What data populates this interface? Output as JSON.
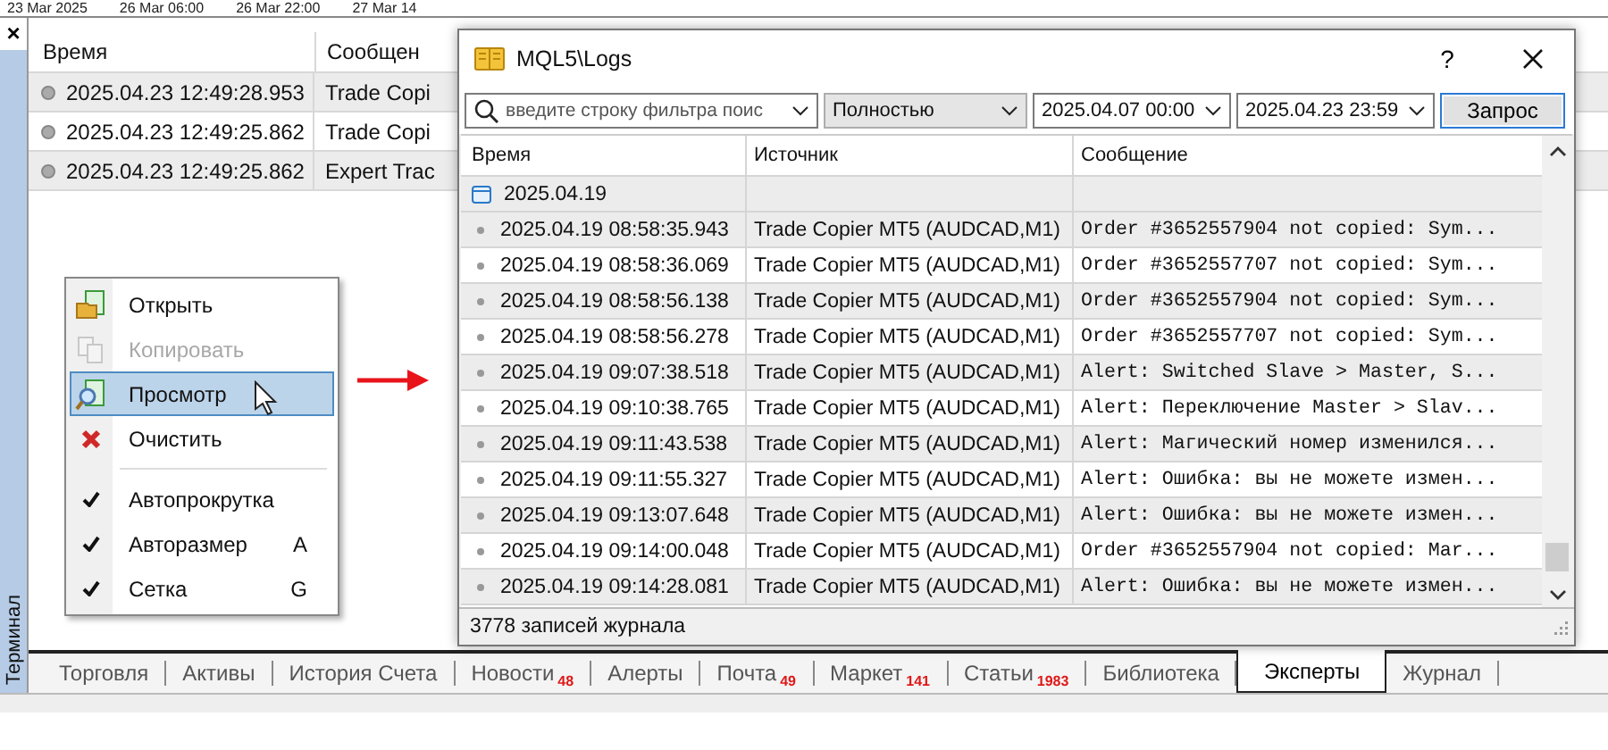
{
  "chart_axis": {
    "labels": [
      "23 Mar 2025",
      "26 Mar 06:00",
      "26 Mar 22:00",
      "27 Mar 14"
    ]
  },
  "terminal": {
    "label": "Терминал",
    "close": "×",
    "table": {
      "columns": [
        "Время",
        "Сообщен"
      ],
      "rows": [
        {
          "time": "2025.04.23 12:49:28.953",
          "message": "Trade Copi"
        },
        {
          "time": "2025.04.23 12:49:25.862",
          "message": "Trade Copi"
        },
        {
          "time": "2025.04.23 12:49:25.862",
          "message": "Expert Trac"
        }
      ]
    },
    "tabs": [
      {
        "label": "Торговля",
        "selected": false
      },
      {
        "label": "Активы",
        "selected": false
      },
      {
        "label": "История Счета",
        "selected": false
      },
      {
        "label": "Новости",
        "badge": "48",
        "selected": false
      },
      {
        "label": "Алерты",
        "selected": false
      },
      {
        "label": "Почта",
        "badge": "49",
        "selected": false
      },
      {
        "label": "Маркет",
        "badge": "141",
        "selected": false
      },
      {
        "label": "Статьи",
        "badge": "1983",
        "selected": false
      },
      {
        "label": "Библиотека",
        "selected": false
      },
      {
        "label": "Эксперты",
        "selected": true
      },
      {
        "label": "Журнал",
        "selected": false
      }
    ]
  },
  "context_menu": {
    "items": [
      {
        "kind": "action",
        "label": "Открыть",
        "disabled": false,
        "selected": false
      },
      {
        "kind": "action",
        "label": "Копировать",
        "disabled": true,
        "selected": false
      },
      {
        "kind": "action",
        "label": "Просмотр",
        "disabled": false,
        "selected": true
      },
      {
        "kind": "action",
        "label": "Очистить",
        "disabled": false,
        "selected": false
      },
      {
        "kind": "separator"
      },
      {
        "kind": "check",
        "label": "Автопрокрутка",
        "checked": true
      },
      {
        "kind": "check",
        "label": "Авторазмер",
        "shortcut": "A",
        "checked": true
      },
      {
        "kind": "check",
        "label": "Сетка",
        "shortcut": "G",
        "checked": true
      }
    ]
  },
  "dialog": {
    "title": "MQL5\\Logs",
    "help": "?",
    "toolbar": {
      "search": {
        "placeholder": "введите строку фильтра поис"
      },
      "mode": "Полностью",
      "from": "2025.04.07 00:00",
      "to": "2025.04.23 23:59",
      "button": "Запрос"
    },
    "table": {
      "columns": [
        "Время",
        "Источник",
        "Сообщение"
      ],
      "group": "2025.04.19",
      "rows": [
        {
          "time": "2025.04.19 08:58:35.943",
          "source": "Trade Copier MT5 (AUDCAD,M1)",
          "message": "Order #3652557904 not copied: Sym..."
        },
        {
          "time": "2025.04.19 08:58:36.069",
          "source": "Trade Copier MT5 (AUDCAD,M1)",
          "message": "Order #3652557707 not copied: Sym..."
        },
        {
          "time": "2025.04.19 08:58:56.138",
          "source": "Trade Copier MT5 (AUDCAD,M1)",
          "message": "Order #3652557904 not copied: Sym..."
        },
        {
          "time": "2025.04.19 08:58:56.278",
          "source": "Trade Copier MT5 (AUDCAD,M1)",
          "message": "Order #3652557707 not copied: Sym..."
        },
        {
          "time": "2025.04.19 09:07:38.518",
          "source": "Trade Copier MT5 (AUDCAD,M1)",
          "message": "Alert: Switched Slave > Master, S..."
        },
        {
          "time": "2025.04.19 09:10:38.765",
          "source": "Trade Copier MT5 (AUDCAD,M1)",
          "message": "Alert: Переключение Master > Slav..."
        },
        {
          "time": "2025.04.19 09:11:43.538",
          "source": "Trade Copier MT5 (AUDCAD,M1)",
          "message": "Alert: Магический номер изменился..."
        },
        {
          "time": "2025.04.19 09:11:55.327",
          "source": "Trade Copier MT5 (AUDCAD,M1)",
          "message": "Alert: Ошибка: вы не можете измен..."
        },
        {
          "time": "2025.04.19 09:13:07.648",
          "source": "Trade Copier MT5 (AUDCAD,M1)",
          "message": "Alert: Ошибка: вы не можете измен..."
        },
        {
          "time": "2025.04.19 09:14:00.048",
          "source": "Trade Copier MT5 (AUDCAD,M1)",
          "message": "Order #3652557904 not copied: Mar..."
        },
        {
          "time": "2025.04.19 09:14:28.081",
          "source": "Trade Copier MT5 (AUDCAD,M1)",
          "message": "Alert: Ошибка: вы не можете измен..."
        }
      ]
    },
    "status": "3778 записей журнала"
  }
}
